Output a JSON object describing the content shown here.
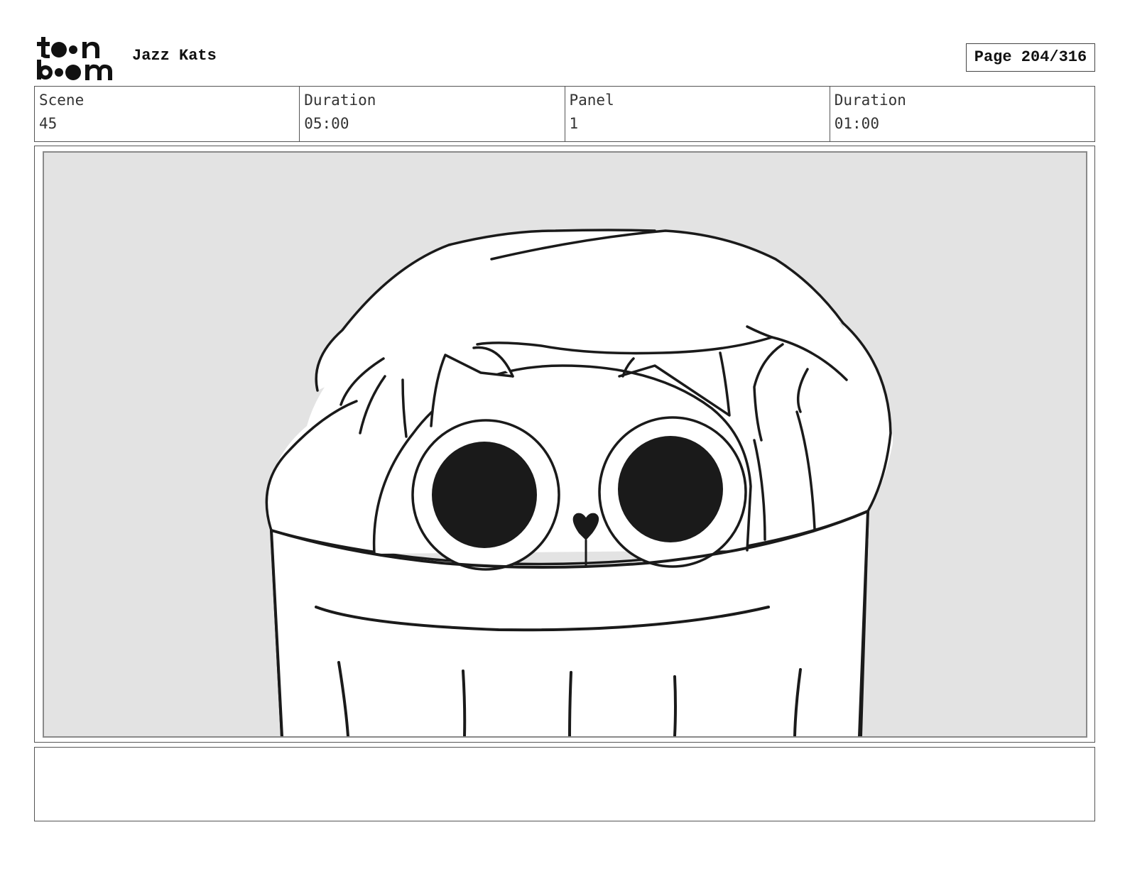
{
  "brand": {
    "logo_name": "toon boom",
    "logo_icon": "toonboom-logo"
  },
  "header": {
    "project_title": "Jazz Kats",
    "page_label": "Page 204/316"
  },
  "info": {
    "scene_label": "Scene",
    "scene_value": "45",
    "scene_duration_label": "Duration",
    "scene_duration_value": "05:00",
    "panel_label": "Panel",
    "panel_value": "1",
    "panel_duration_label": "Duration",
    "panel_duration_value": "01:00"
  },
  "panel": {
    "illustration": "cat-peeking-from-trash-can",
    "background_color": "#e3e3e3",
    "line_color": "#1a1a1a"
  },
  "notes": {
    "text": ""
  }
}
